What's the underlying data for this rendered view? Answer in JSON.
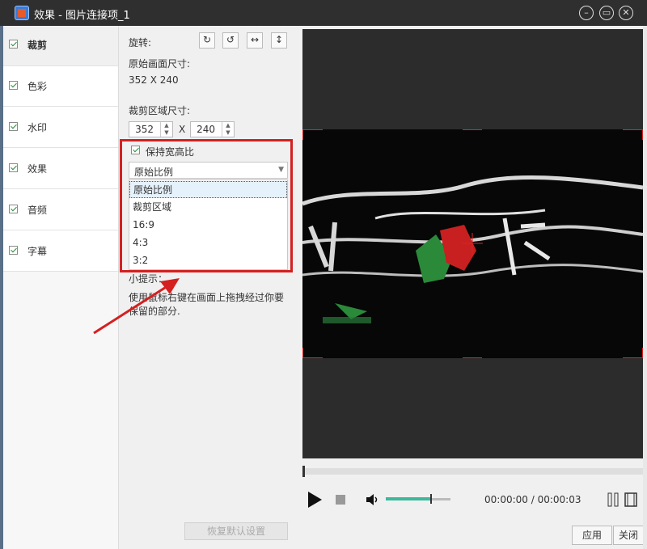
{
  "window": {
    "title": "效果 - 图片连接项_1",
    "controls": [
      "close-circle-icon",
      "restore-icon",
      "close-icon"
    ]
  },
  "sidebar": {
    "items": [
      {
        "label": "裁剪",
        "checked": true,
        "active": true
      },
      {
        "label": "色彩",
        "checked": true,
        "active": false
      },
      {
        "label": "水印",
        "checked": true,
        "active": false
      },
      {
        "label": "效果",
        "checked": true,
        "active": false
      },
      {
        "label": "音频",
        "checked": true,
        "active": false
      },
      {
        "label": "字幕",
        "checked": true,
        "active": false
      }
    ]
  },
  "crop": {
    "rotate_label": "旋转:",
    "rotate_buttons": [
      "rotate-cw-icon",
      "rotate-ccw-icon",
      "flip-horizontal-icon",
      "flip-vertical-icon"
    ],
    "original_size_label": "原始画面尺寸:",
    "original_size_value": "352 X 240",
    "crop_size_label": "裁剪区域尺寸:",
    "width_value": "352",
    "times": "X",
    "height_value": "240",
    "keep_ratio_label": "保持宽高比",
    "keep_ratio_checked": true,
    "ratio_selected": "原始比例",
    "ratio_options": [
      "原始比例",
      "裁剪区域",
      "16:9",
      "4:3",
      "3:2"
    ],
    "tip_title": "小提示：",
    "tip_text_line1": "使用鼠标右键在画面上拖拽经过你要",
    "tip_text_line2": "保留的部分.",
    "restore_button": "恢复默认设置"
  },
  "player": {
    "time": "00:00:00 / 00:00:03",
    "volume": 0.7,
    "progress": 0.0,
    "icons": [
      "play-icon",
      "stop-icon",
      "volume-icon",
      "split-icon",
      "film-icon"
    ]
  },
  "footer": {
    "apply_label": "应用",
    "close_label": "关闭"
  },
  "colors": {
    "accent_red": "#d42020",
    "volume_fill": "#3cb99a",
    "titlebar": "#2f2f2f"
  }
}
